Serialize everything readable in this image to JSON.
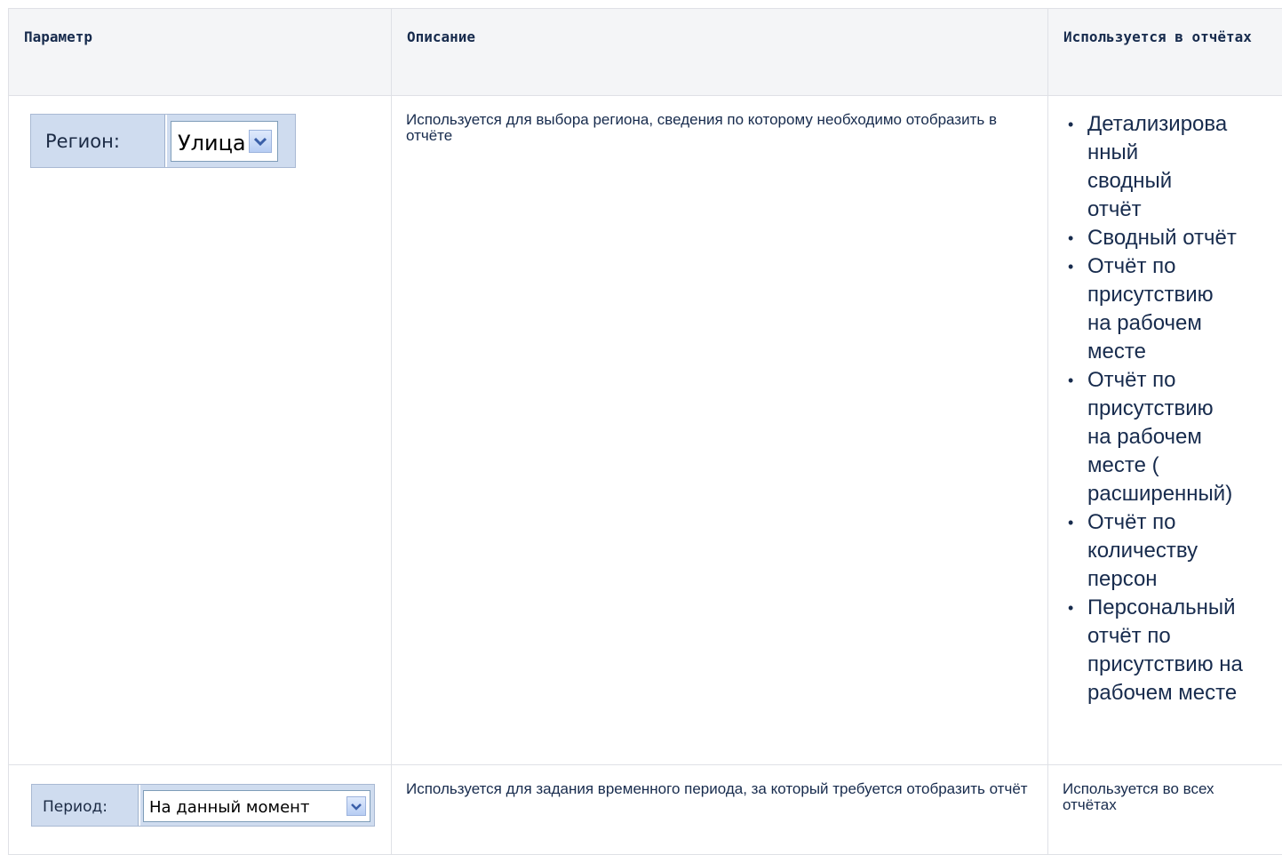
{
  "table": {
    "headers": [
      "Параметр",
      "Описание",
      "Используется в отчётах"
    ],
    "rows": [
      {
        "widget": {
          "label": "Регион:",
          "value": "Улица"
        },
        "description": "Используется для выбора региона, сведения по которому необходимо отобразить в отчёте",
        "reports": [
          "Детализирова нный сводный отчёт",
          "Сводный отчёт",
          "Отчёт по присутствию на рабочем месте",
          "Отчёт по присутствию на рабочем месте ( расширенный)",
          "Отчёт по количеству персон",
          "Персональный отчёт по присутствию на рабочем месте"
        ]
      },
      {
        "widget": {
          "label": "Период:",
          "value": "На данный момент"
        },
        "description": "Используется для задания временного периода, за который требуется отобразить отчёт",
        "reports_text": "Используется во всех отчётах"
      }
    ]
  },
  "colors": {
    "widget_bg": "#cfdcef",
    "header_bg": "#f4f5f7",
    "border": "#dfe1e6"
  },
  "icons": {
    "dropdown": "chevron-down-icon"
  }
}
